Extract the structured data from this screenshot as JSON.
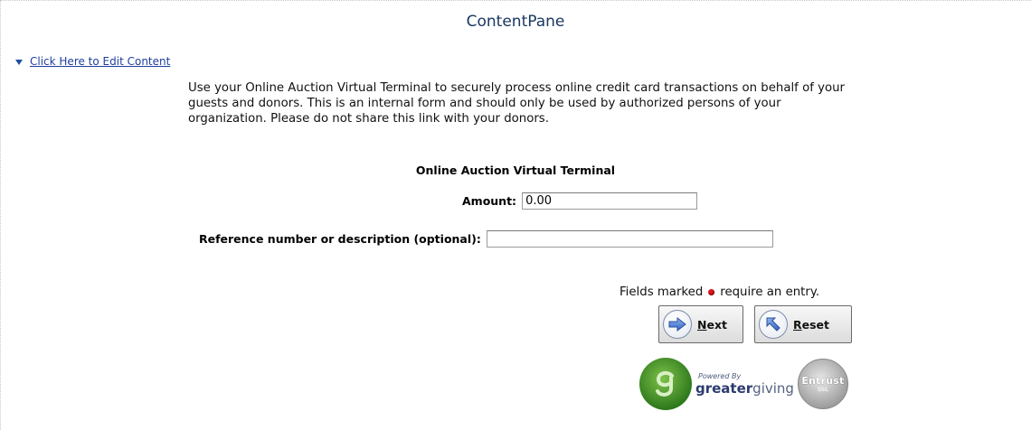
{
  "pane": {
    "title": "ContentPane"
  },
  "edit_link": {
    "label": "Click Here to Edit Content"
  },
  "intro": {
    "text": "Use your Online Auction Virtual Terminal to securely process online credit card transactions on behalf of your guests and donors. This is an internal form and should only be used by authorized persons of your organization. Please do not share this link with your donors."
  },
  "form": {
    "title": "Online Auction Virtual Terminal",
    "amount_label": "Amount:",
    "amount_value": "0.00",
    "reference_label": "Reference number or description (optional):",
    "reference_value": "",
    "required_note_before": "Fields marked",
    "required_note_after": "require an entry."
  },
  "buttons": {
    "next_label": "Next",
    "reset_label": "Reset",
    "next_icon": "arrow-right-icon",
    "reset_icon": "arrow-up-left-icon"
  },
  "footer": {
    "powered_by": "Powered By",
    "brand_bold": "greater",
    "brand_light": "giving",
    "badge_main": "Entrust",
    "badge_sub": "SSL",
    "badge_ring_top": "SECURED BY",
    "badge_ring_bottom": "VERIFY"
  },
  "colors": {
    "title": "#1a3760",
    "link": "#1f3f9e",
    "required_dot": "#d8161b"
  }
}
